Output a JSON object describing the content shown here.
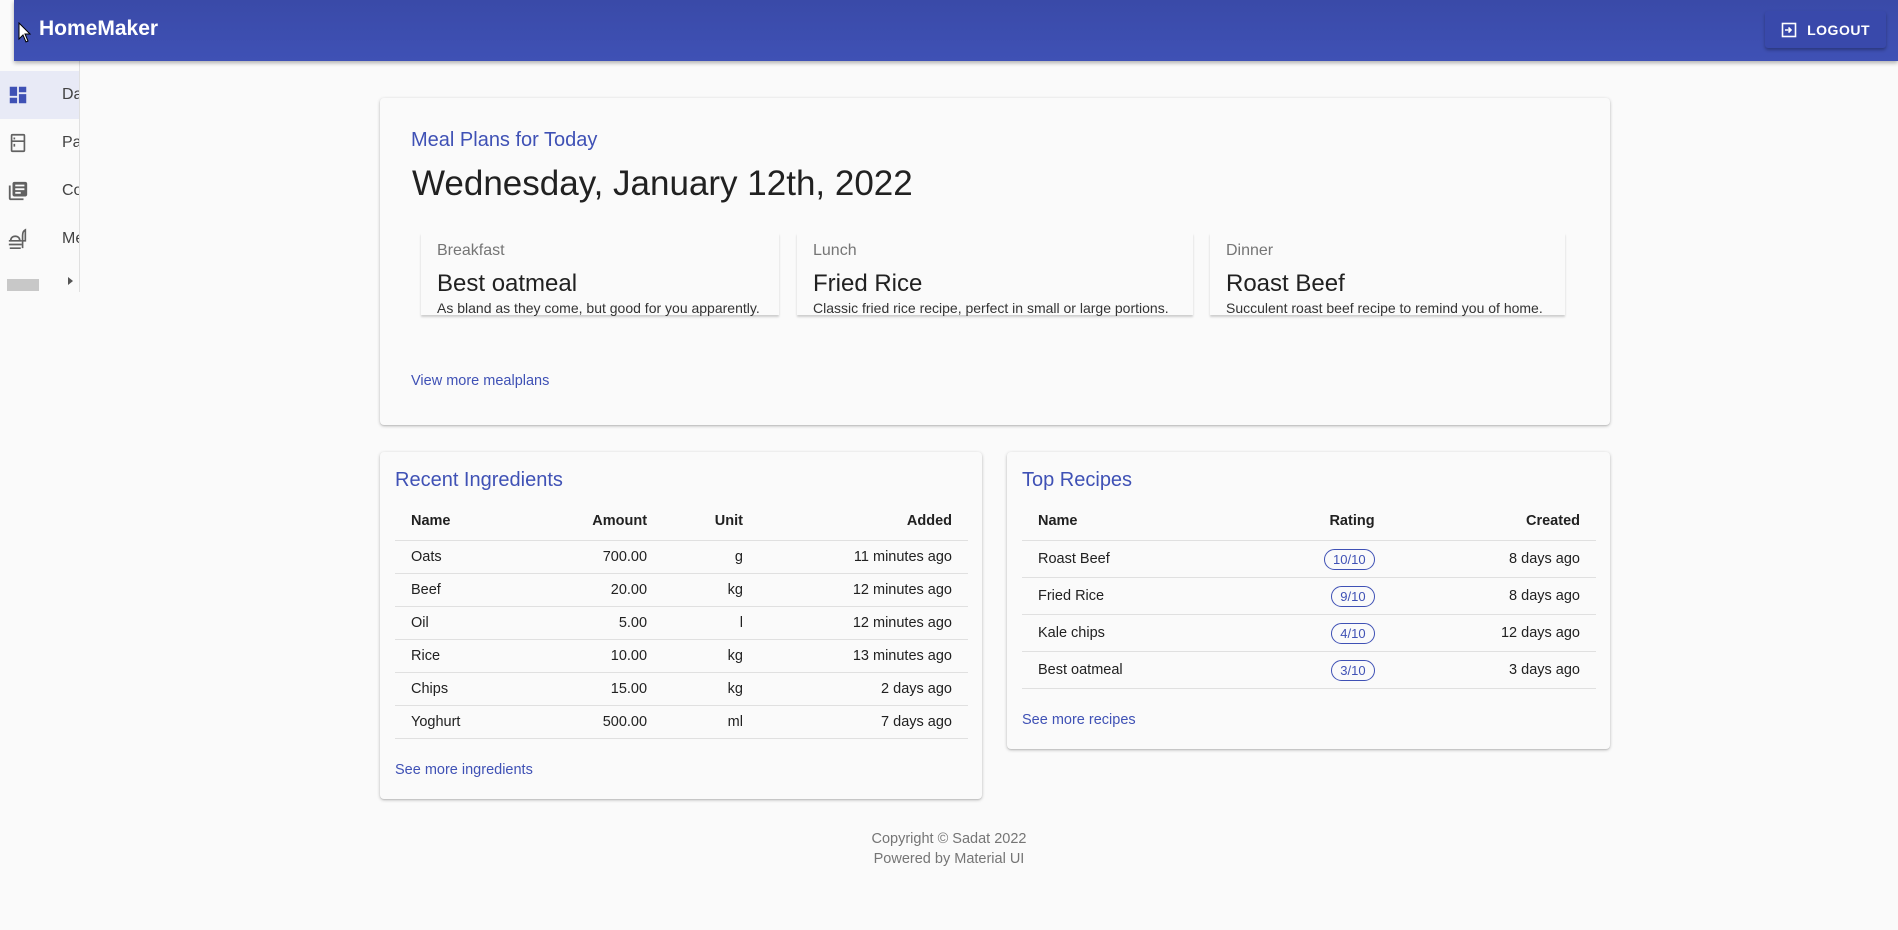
{
  "app": {
    "title": "HomeMaker",
    "logout_label": "LOGOUT"
  },
  "sidebar": {
    "items": [
      {
        "label": "Dashboard",
        "icon": "dashboard-icon",
        "active": true
      },
      {
        "label": "Pantry",
        "icon": "fridge-icon",
        "active": false
      },
      {
        "label": "Cookbook",
        "icon": "library-books-icon",
        "active": false
      },
      {
        "label": "Meal Plans",
        "icon": "food-icon",
        "active": false
      }
    ]
  },
  "meal_plans": {
    "heading": "Meal Plans for Today",
    "date": "Wednesday, January 12th, 2022",
    "meals": [
      {
        "type": "Breakfast",
        "name": "Best oatmeal",
        "description": "As bland as they come, but good for you apparently."
      },
      {
        "type": "Lunch",
        "name": "Fried Rice",
        "description": "Classic fried rice recipe, perfect in small or large portions."
      },
      {
        "type": "Dinner",
        "name": "Roast Beef",
        "description": "Succulent roast beef recipe to remind you of home."
      }
    ],
    "more_link": "View more mealplans"
  },
  "ingredients": {
    "heading": "Recent Ingredients",
    "columns": [
      "Name",
      "Amount",
      "Unit",
      "Added"
    ],
    "rows": [
      [
        "Oats",
        "700.00",
        "g",
        "11 minutes ago"
      ],
      [
        "Beef",
        "20.00",
        "kg",
        "12 minutes ago"
      ],
      [
        "Oil",
        "5.00",
        "l",
        "12 minutes ago"
      ],
      [
        "Rice",
        "10.00",
        "kg",
        "13 minutes ago"
      ],
      [
        "Chips",
        "15.00",
        "kg",
        "2 days ago"
      ],
      [
        "Yoghurt",
        "500.00",
        "ml",
        "7 days ago"
      ]
    ],
    "more_link": "See more ingredients"
  },
  "recipes": {
    "heading": "Top Recipes",
    "columns": [
      "Name",
      "Rating",
      "Created"
    ],
    "rows": [
      [
        "Roast Beef",
        "10/10",
        "8 days ago"
      ],
      [
        "Fried Rice",
        "9/10",
        "8 days ago"
      ],
      [
        "Kale chips",
        "4/10",
        "12 days ago"
      ],
      [
        "Best oatmeal",
        "3/10",
        "3 days ago"
      ]
    ],
    "more_link": "See more recipes"
  },
  "footer": {
    "copyright": "Copyright © Sadat 2022",
    "powered": "Powered by Material UI"
  },
  "colors": {
    "primary": "#3f51b5",
    "appbar": "#3a4aa8"
  }
}
